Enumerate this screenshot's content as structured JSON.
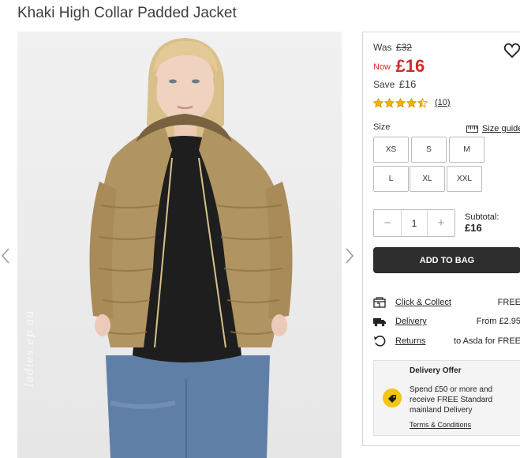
{
  "product": {
    "title": "Khaki High Collar Padded Jacket"
  },
  "gallery": {
    "watermark": "ladies.ep.au"
  },
  "price": {
    "was_label": "Was",
    "was_value": "£32",
    "now_label": "Now",
    "now_value": "£16",
    "save_label": "Save",
    "save_value": "£16",
    "color_now": "#d12a2a"
  },
  "rating": {
    "value": 4.5,
    "max": 5,
    "count_text": "(10)"
  },
  "size": {
    "label": "Size",
    "guide_label": "Size guide",
    "options": [
      "XS",
      "S",
      "M",
      "L",
      "XL",
      "XXL"
    ]
  },
  "quantity": {
    "minus": "−",
    "value": "1",
    "plus": "+"
  },
  "subtotal": {
    "label": "Subtotal:",
    "value": "£16"
  },
  "cart": {
    "add_label": "ADD TO BAG",
    "button_color": "#2e2e2e"
  },
  "delivery": [
    {
      "icon": "store-icon",
      "name": "Click & Collect",
      "value": "FREE"
    },
    {
      "icon": "truck-icon",
      "name": "Delivery",
      "value": "From £2.95"
    },
    {
      "icon": "return-icon",
      "name": "Returns",
      "value": "to Asda for FREE"
    }
  ],
  "offer": {
    "title": "Delivery Offer",
    "icon": "tag-icon",
    "icon_color": "#f3c316",
    "text": "Spend £50 or more and receive FREE Standard mainland Delivery",
    "link": "Terms & Conditions"
  }
}
